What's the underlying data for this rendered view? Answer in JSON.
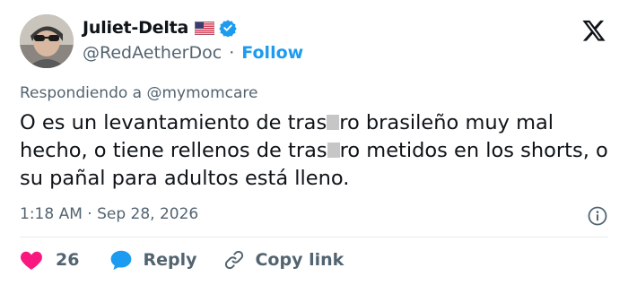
{
  "author": {
    "display_name": "Juliet-Delta",
    "handle": "@RedAetherDoc",
    "separator": "·",
    "follow_label": "Follow",
    "verified": true,
    "flag": "us-flag-icon"
  },
  "reply_context": "Respondiendo a @mymomcare",
  "tweet": {
    "line1_a": "O es un levantamiento de tras",
    "line1_b": "ro brasileño muy mal hecho, o tiene rellenos de tras",
    "line1_c": "ro metidos en los shorts, o su pañal para adultos está lleno."
  },
  "timestamp": "1:18 AM · Sep 28, 2026",
  "actions": {
    "like_count": "26",
    "reply_label": "Reply",
    "copy_label": "Copy link"
  },
  "colors": {
    "link_blue": "#1d9bf0",
    "like_red": "#f91880",
    "muted_gray": "#536471",
    "text_dark": "#0f1419"
  }
}
